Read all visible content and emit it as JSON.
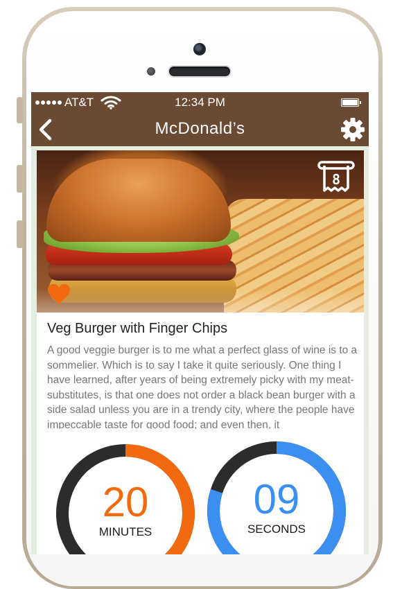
{
  "status_bar": {
    "carrier": "AT&T",
    "time": "12:34 PM"
  },
  "nav": {
    "title": "McDonald’s",
    "back_icon": "chevron-left-icon",
    "settings_icon": "gear-icon"
  },
  "item": {
    "receipt_count": "8",
    "favorite_icon": "heart-icon",
    "title": "Veg Burger with Finger Chips",
    "description": "A good veggie burger is to me what a perfect glass of wine is to a sommelier. Which is to say I take it quite seriously. One thing I have learned, after years of being extremely picky with my meat-substitutes, is that one does not order a black bean burger with a side salad unless you are in a trendy city, where the people have impeccable taste for good food; and even then, it"
  },
  "timers": [
    {
      "value": "20",
      "unit": "MINUTES",
      "progress": 0.42,
      "color": "#f26a10"
    },
    {
      "value": "09",
      "unit": "SECONDS",
      "progress": 0.8,
      "color": "#3a8ff0"
    }
  ],
  "colors": {
    "brand_brown": "#6b4a33",
    "accent_orange": "#f26a10",
    "accent_blue": "#3a8ff0",
    "ring_track": "#2c2c2c"
  }
}
